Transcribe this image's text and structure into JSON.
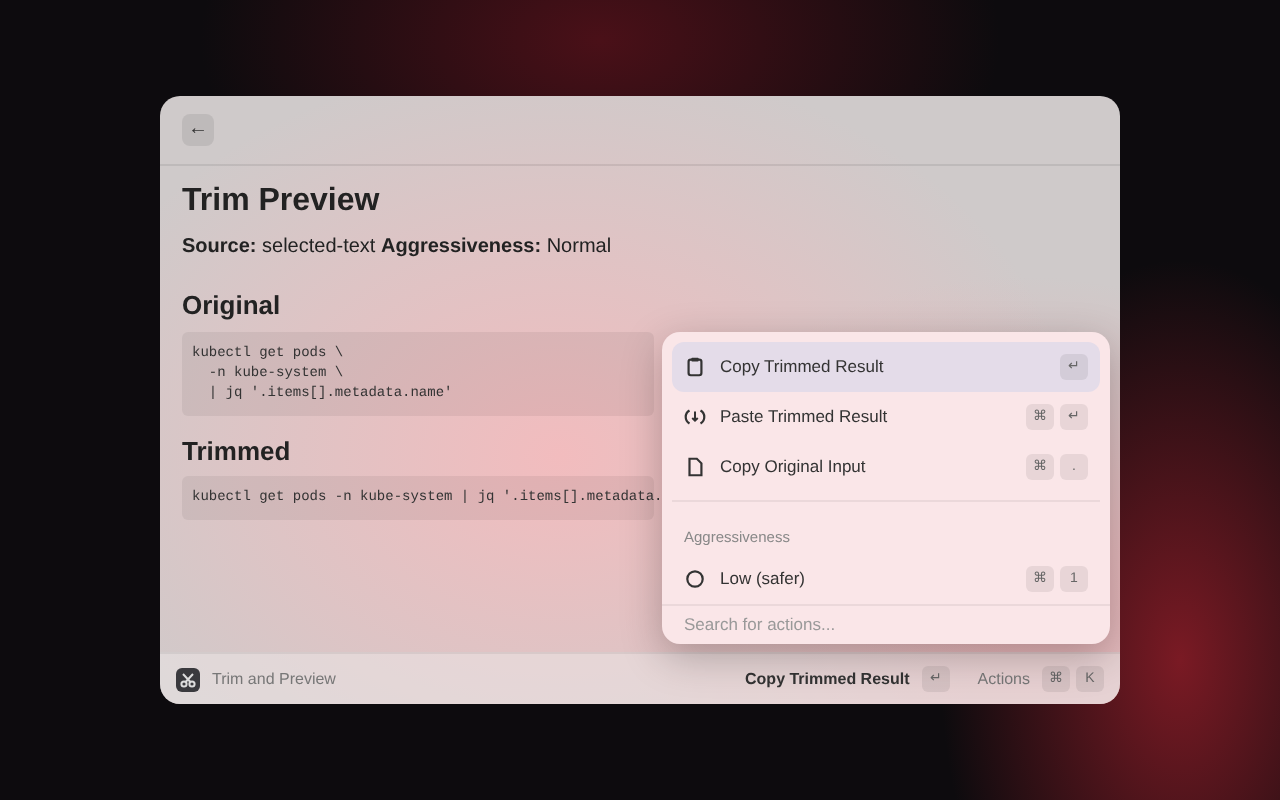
{
  "window": {
    "back_button": "←",
    "title": "Trim Preview",
    "meta": "**Source:** selected-text **Aggressiveness:** Normal"
  },
  "sections": [
    {
      "heading": "Original",
      "code": "kubectl get pods \\\n  -n kube-system \\\n  | jq '.items[].metadata.name'"
    },
    {
      "heading": "Trimmed",
      "code": "kubectl get pods -n kube-system | jq '.items[].metadata."
    }
  ],
  "actions_menu": {
    "items": [
      {
        "kind": "action",
        "label": "Copy Trimmed Result",
        "keys": [
          "↵"
        ],
        "selected": true
      },
      {
        "kind": "action",
        "label": "Paste Trimmed Result",
        "keys": [
          "⌘",
          "↵"
        ],
        "selected": false
      },
      {
        "kind": "action",
        "label": "Copy Original Input",
        "keys": [
          "⌘",
          "."
        ],
        "selected": false
      },
      {
        "kind": "header",
        "label": "Aggressiveness"
      },
      {
        "kind": "action",
        "label": "Low (safer)",
        "keys": [
          "⌘",
          "1"
        ],
        "selected": false
      }
    ],
    "search": {
      "placeholder": "Search for actions..."
    }
  },
  "footer": {
    "app_name": "Trim and Preview",
    "primary_action": "Copy Trimmed Result",
    "primary_keys": [
      "↵"
    ],
    "actions_label": "Actions",
    "actions_keys": [
      "⌘",
      "K"
    ]
  }
}
